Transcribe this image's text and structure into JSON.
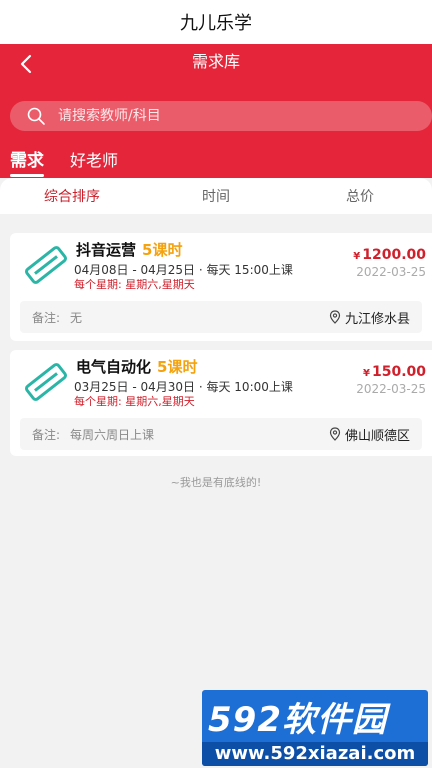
{
  "app": {
    "title": "九儿乐学"
  },
  "header": {
    "page_title": "需求库"
  },
  "search": {
    "placeholder": "请搜索教师/科目",
    "value": ""
  },
  "tabs": [
    {
      "label": "需求",
      "active": true
    },
    {
      "label": "好老师",
      "active": false
    }
  ],
  "sort": [
    {
      "label": "综合排序",
      "active": true
    },
    {
      "label": "时间",
      "active": false
    },
    {
      "label": "总价",
      "active": false
    }
  ],
  "cards": [
    {
      "title": "抖音运营",
      "hours": "5课时",
      "time": "04月08日 - 04月25日 · 每天 15:00上课",
      "week": "每个星期:  星期六,星期天",
      "currency": "¥",
      "price": "1200.00",
      "date": "2022-03-25",
      "note_label": "备注:",
      "note": "无",
      "location": "九江修水县"
    },
    {
      "title": "电气自动化",
      "hours": "5课时",
      "time": "03月25日 - 04月30日 · 每天 10:00上课",
      "week": "每个星期:  星期六,星期天",
      "currency": "¥",
      "price": "150.00",
      "date": "2022-03-25",
      "note_label": "备注:",
      "note": "每周六周日上课",
      "location": "佛山顺德区"
    }
  ],
  "footer": {
    "text": "~我也是有底线的!"
  },
  "watermark": {
    "name": "592软件园",
    "url": "www.592xiazai.com"
  },
  "colors": {
    "brand_red": "#e5263a",
    "accent_orange": "#f4a20e",
    "price_red": "#d0202c",
    "icon_teal": "#2bb5a6"
  },
  "icons": [
    "chevron-left-icon",
    "search-icon",
    "eraser-icon",
    "location-pin-icon"
  ]
}
